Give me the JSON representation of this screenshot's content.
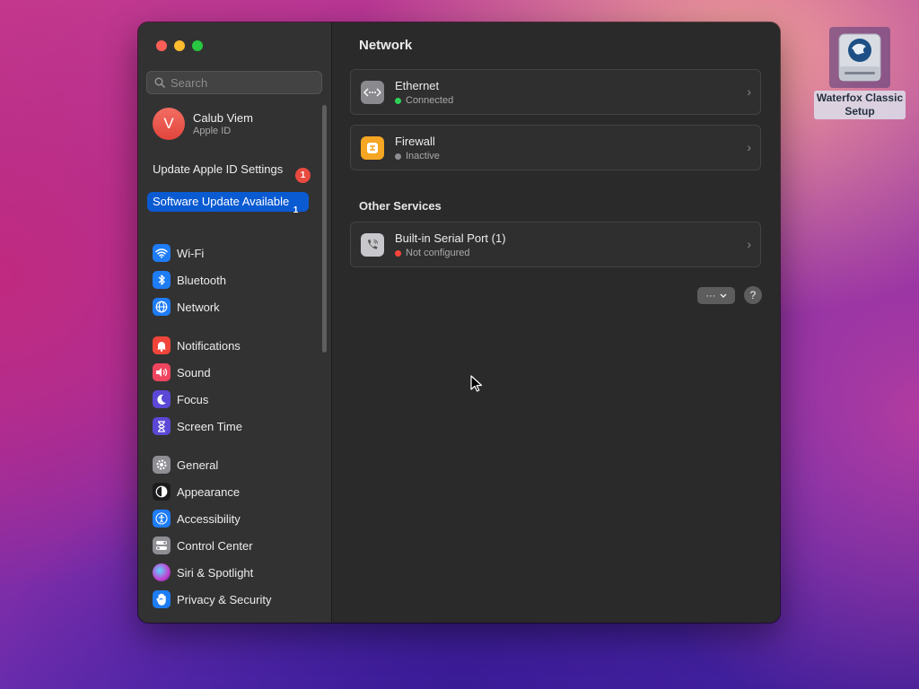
{
  "sidebar": {
    "search_placeholder": "Search",
    "account": {
      "initial": "V",
      "name": "Calub Viem",
      "subtitle": "Apple ID"
    },
    "notices": [
      {
        "label": "Update Apple ID Settings",
        "badge": "1"
      },
      {
        "label": "Software Update Available",
        "badge": "1"
      }
    ],
    "items": [
      {
        "label": "Wi-Fi",
        "icon": "wifi-icon",
        "color": "#1e7cf5"
      },
      {
        "label": "Bluetooth",
        "icon": "bluetooth-icon",
        "color": "#1e7cf5"
      },
      {
        "label": "Network",
        "icon": "globe-icon",
        "color": "#1e7cf5"
      },
      {
        "label": "Notifications",
        "icon": "bell-icon",
        "color": "#f0453a"
      },
      {
        "label": "Sound",
        "icon": "speaker-icon",
        "color": "#f0455f"
      },
      {
        "label": "Focus",
        "icon": "moon-icon",
        "color": "#5b48d6"
      },
      {
        "label": "Screen Time",
        "icon": "hourglass-icon",
        "color": "#5b48d6"
      },
      {
        "label": "General",
        "icon": "gear-icon",
        "color": "#8e8e93"
      },
      {
        "label": "Appearance",
        "icon": "appearance-icon",
        "color": "#1c1c1e"
      },
      {
        "label": "Accessibility",
        "icon": "accessibility-icon",
        "color": "#1e7cf5"
      },
      {
        "label": "Control Center",
        "icon": "toggles-icon",
        "color": "#8e8e93"
      },
      {
        "label": "Siri & Spotlight",
        "icon": "siri-icon",
        "color": "#c33fcd"
      },
      {
        "label": "Privacy & Security",
        "icon": "hand-icon",
        "color": "#1e7cf5"
      }
    ]
  },
  "main": {
    "title": "Network",
    "services": [
      {
        "title": "Ethernet",
        "status": "Connected",
        "status_color": "#30d158",
        "icon": "ethernet-icon"
      },
      {
        "title": "Firewall",
        "status": "Inactive",
        "status_color": "#8e8e93",
        "icon": "firewall-icon"
      }
    ],
    "other_title": "Other Services",
    "other_services": [
      {
        "title": "Built-in Serial Port (1)",
        "status": "Not configured",
        "status_color": "#ff453a",
        "icon": "phone-icon"
      }
    ],
    "more_label": "···",
    "help_label": "?"
  },
  "desktop": {
    "icon_label_line1": "Waterfox Classic",
    "icon_label_line2": "Setup"
  }
}
